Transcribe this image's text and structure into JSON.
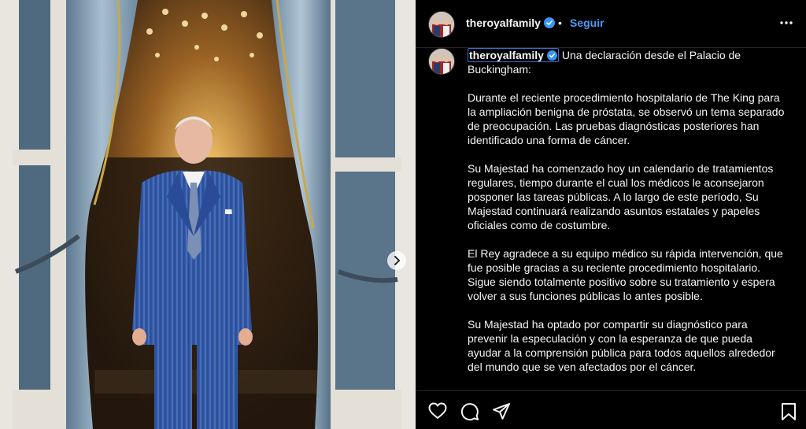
{
  "post": {
    "username": "theroyalfamily",
    "follow_label": "Seguir",
    "dot": "•"
  },
  "caption": {
    "username": "theroyalfamily",
    "first_line": "Una declaración desde el Palacio de Buckingham:",
    "paragraphs": [
      "Durante el reciente procedimiento hospitalario de The King para la ampliación benigna de próstata, se observó un tema separado de preocupación. Las pruebas diagnósticas posteriores han identificado una forma de cáncer.",
      "Su Majestad ha comenzado hoy un calendario de tratamientos regulares, tiempo durante el cual los médicos le aconsejaron posponer las tareas públicas. A lo largo de este período, Su Majestad continuará realizando asuntos estatales y papeles oficiales como de costumbre.",
      "El Rey agradece a su equipo médico su rápida intervención, que fue posible gracias a su reciente procedimiento hospitalario. Sigue siendo totalmente positivo sobre su tratamiento y espera volver a sus funciones públicas lo antes posible.",
      "Su Majestad ha optado por compartir su diagnóstico para prevenir la especulación y con la esperanza de que pueda ayudar a la comprensión pública para todos aquellos alrededor del mundo que se ven afectados por el cáncer."
    ]
  },
  "colors": {
    "accent": "#4a9bf7",
    "background": "#000000",
    "verified": "#3897f0"
  },
  "icons": {
    "like": "heart-icon",
    "comment": "comment-icon",
    "share": "share-icon",
    "save": "bookmark-icon",
    "more": "more-icon",
    "next": "chevron-right-icon"
  }
}
